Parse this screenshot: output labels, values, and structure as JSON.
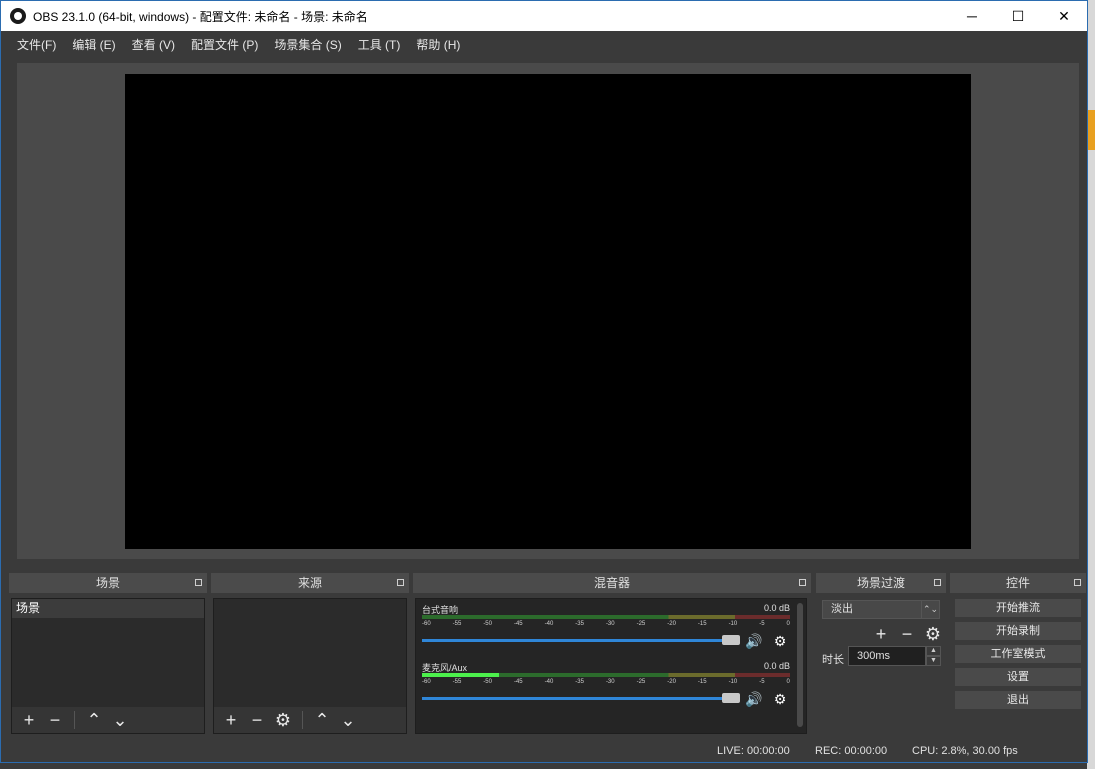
{
  "window": {
    "title": "OBS 23.1.0 (64-bit, windows) - 配置文件: 未命名 - 场景: 未命名",
    "minimize": "─",
    "maximize": "☐",
    "close": "✕"
  },
  "menu": [
    "文件(F)",
    "编辑 (E)",
    "查看 (V)",
    "配置文件 (P)",
    "场景集合 (S)",
    "工具 (T)",
    "帮助 (H)"
  ],
  "docks": {
    "scenes": {
      "title": "场景",
      "items": [
        "场景"
      ]
    },
    "sources": {
      "title": "来源"
    },
    "mixer": {
      "title": "混音器",
      "channels": [
        {
          "name": "台式音响",
          "db": "0.0 dB",
          "level": 0.0
        },
        {
          "name": "麦克风/Aux",
          "db": "0.0 dB",
          "level": 0.21
        }
      ],
      "scale": [
        "-60",
        "-55",
        "-50",
        "-45",
        "-40",
        "-35",
        "-30",
        "-25",
        "-20",
        "-15",
        "-10",
        "-5",
        "0"
      ]
    },
    "transitions": {
      "title": "场景过渡",
      "selected": "淡出",
      "duration_label": "时长",
      "duration_value": "300ms"
    },
    "controls": {
      "title": "控件",
      "buttons": [
        "开始推流",
        "开始录制",
        "工作室模式",
        "设置",
        "退出"
      ]
    }
  },
  "status": {
    "live": "LIVE: 00:00:00",
    "rec": "REC: 00:00:00",
    "cpu": "CPU: 2.8%, 30.00 fps"
  },
  "icons": {
    "add": "+",
    "remove": "−",
    "up": "⌃",
    "down": "⌄",
    "gear": "⚙",
    "speaker": "🔊"
  }
}
